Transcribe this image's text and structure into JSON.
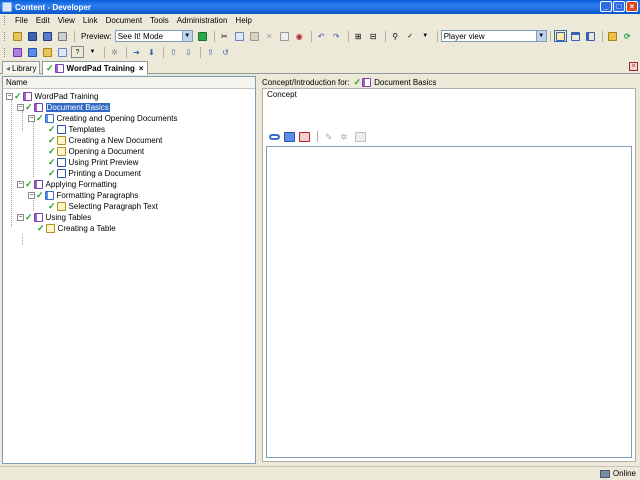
{
  "window": {
    "title": "Content - Developer"
  },
  "menu": [
    {
      "label": "File",
      "key": "F"
    },
    {
      "label": "Edit",
      "key": "E"
    },
    {
      "label": "View",
      "key": "V"
    },
    {
      "label": "Link",
      "key": "L"
    },
    {
      "label": "Document",
      "key": "D"
    },
    {
      "label": "Tools",
      "key": "T"
    },
    {
      "label": "Administration",
      "key": "A"
    },
    {
      "label": "Help",
      "key": "H"
    }
  ],
  "toolbar": {
    "preview_label": "Preview:",
    "preview_mode": "See It! Mode",
    "player_view": "Player view"
  },
  "tabs": [
    {
      "label": "Library",
      "active": false
    },
    {
      "label": "WordPad Training",
      "active": true
    }
  ],
  "left_pane": {
    "column_header": "Name",
    "tree": [
      {
        "label": "WordPad Training",
        "type": "book"
      },
      {
        "label": "Document Basics",
        "type": "book",
        "selected": true
      },
      {
        "label": "Creating and Opening Documents",
        "type": "topic"
      },
      {
        "label": "Templates",
        "type": "concept"
      },
      {
        "label": "Creating a New Document",
        "type": "sim"
      },
      {
        "label": "Opening a Document",
        "type": "sim"
      },
      {
        "label": "Using Print Preview",
        "type": "concept"
      },
      {
        "label": "Printing a Document",
        "type": "concept"
      },
      {
        "label": "Applying Formatting",
        "type": "book"
      },
      {
        "label": "Formatting Paragraphs",
        "type": "topic"
      },
      {
        "label": "Selecting Paragraph Text",
        "type": "sim"
      },
      {
        "label": "Using Tables",
        "type": "book"
      },
      {
        "label": "Creating a Table",
        "type": "sim"
      }
    ]
  },
  "right_pane": {
    "header_prefix": "Concept/Introduction for:",
    "header_target": "Document Basics",
    "concept_label": "Concept"
  },
  "status": {
    "connection": "Online"
  },
  "colors": {
    "titlebar": "#0a5fd9",
    "selection": "#316ac5",
    "check": "#23a023"
  }
}
